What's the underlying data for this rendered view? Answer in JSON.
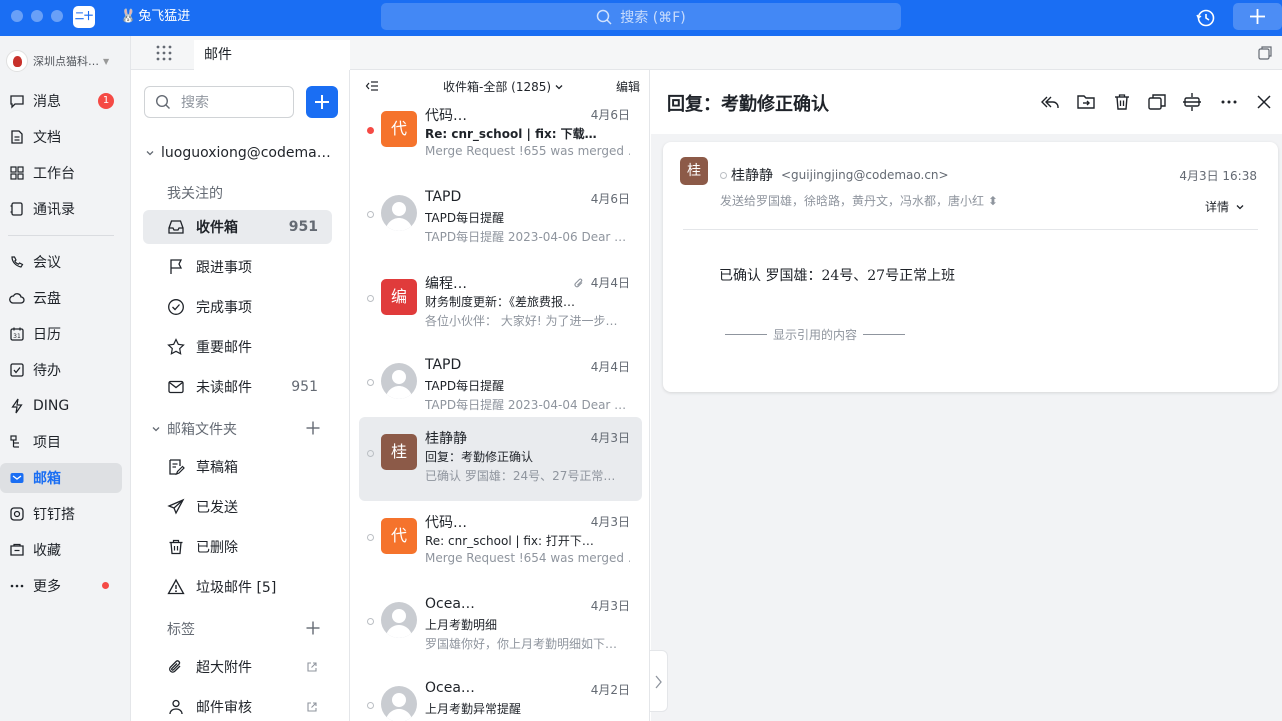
{
  "titlebar": {
    "app_logo_text": "二十",
    "org_tag": "兔飞猛进",
    "search_placeholder": "搜索 (⌘F)"
  },
  "leftnav": {
    "org_name": "深圳点猫科…",
    "items": [
      {
        "label": "消息",
        "icon": "chat-icon",
        "badge": "1"
      },
      {
        "label": "文档",
        "icon": "doc-icon"
      },
      {
        "label": "工作台",
        "icon": "grid-icon"
      },
      {
        "label": "通讯录",
        "icon": "contacts-icon"
      },
      {
        "label": "会议",
        "icon": "meeting-icon"
      },
      {
        "label": "云盘",
        "icon": "cloud-icon"
      },
      {
        "label": "日历",
        "icon": "calendar-icon"
      },
      {
        "label": "待办",
        "icon": "todo-icon"
      },
      {
        "label": "DING",
        "icon": "lightning-icon"
      },
      {
        "label": "项目",
        "icon": "project-icon"
      },
      {
        "label": "邮箱",
        "icon": "mail-icon"
      },
      {
        "label": "钉钉搭",
        "icon": "builder-icon"
      },
      {
        "label": "收藏",
        "icon": "favorite-icon"
      },
      {
        "label": "更多",
        "icon": "more-icon"
      }
    ]
  },
  "tabstrip": {
    "active_tab": "邮件"
  },
  "folders": {
    "search_placeholder": "搜索",
    "account": "luoguoxiong@codema…",
    "followed_header": "我关注的",
    "followed": [
      {
        "label": "收件箱",
        "count": "951"
      },
      {
        "label": "跟进事项",
        "count": ""
      },
      {
        "label": "完成事项",
        "count": ""
      },
      {
        "label": "重要邮件",
        "count": ""
      },
      {
        "label": "未读邮件",
        "count": "951"
      }
    ],
    "mail_folders_header": "邮箱文件夹",
    "mail_folders": [
      {
        "label": "草稿箱"
      },
      {
        "label": "已发送"
      },
      {
        "label": "已删除"
      },
      {
        "label": "垃圾邮件 [5]"
      }
    ],
    "tags_header": "标签",
    "tools": [
      {
        "label": "超大附件"
      },
      {
        "label": "邮件审核"
      }
    ]
  },
  "list": {
    "title": "收件箱-全部 (1285)",
    "edit_label": "编辑",
    "mails": [
      {
        "sender": "代码…",
        "date": "4月6日",
        "subject": "Re: cnr_school | fix: 下载…",
        "preview": "Merge Request !655 was merged …",
        "avatar": "代",
        "unread": true
      },
      {
        "sender": "TAPD",
        "date": "4月6日",
        "subject": "TAPD每日提醒",
        "preview": "TAPD每日提醒 2023-04-06 Dear …",
        "avatar": "",
        "unread": false
      },
      {
        "sender": "编程…",
        "date": "4月4日",
        "subject": "财务制度更新：《差旅费报…",
        "preview": "各位小伙伴： 大家好! 为了进一步…",
        "avatar": "编",
        "unread": false
      },
      {
        "sender": "TAPD",
        "date": "4月4日",
        "subject": "TAPD每日提醒",
        "preview": "TAPD每日提醒 2023-04-04 Dear …",
        "avatar": "",
        "unread": false
      },
      {
        "sender": "桂静静",
        "date": "4月3日",
        "subject": "回复：考勤修正确认",
        "preview": "已确认 罗国雄：24号、27号正常…",
        "avatar": "桂",
        "unread": false
      },
      {
        "sender": "代码…",
        "date": "4月3日",
        "subject": "Re: cnr_school | fix: 打开下…",
        "preview": "Merge Request !654 was merged …",
        "avatar": "代",
        "unread": false
      },
      {
        "sender": "Ocea…",
        "date": "4月3日",
        "subject": "上月考勤明细",
        "preview": "罗国雄你好，你上月考勤明细如下…",
        "avatar": "",
        "unread": false
      },
      {
        "sender": "Ocea…",
        "date": "4月2日",
        "subject": "上月考勤异常提醒",
        "preview": "",
        "avatar": "",
        "unread": false
      }
    ]
  },
  "reader": {
    "title": "回复：考勤修正确认",
    "avatar": "桂",
    "from_name": "桂静静",
    "from_addr": "<guijingjing@codemao.cn>",
    "time": "4月3日 16:38",
    "to_line": "发送给罗国雄，徐晗路，黄丹文，冯水都，唐小红 ⬍",
    "detail_label": "详情",
    "body": "已确认 罗国雄：24号、27号正常上班",
    "quote_toggle": "显示引用的内容"
  },
  "colors": {
    "brand": "#1a6ef3",
    "badge": "#f54a45",
    "avatar_orange": "#f5732c",
    "avatar_red": "#e03b3b",
    "avatar_brown": "#8c5a48"
  }
}
